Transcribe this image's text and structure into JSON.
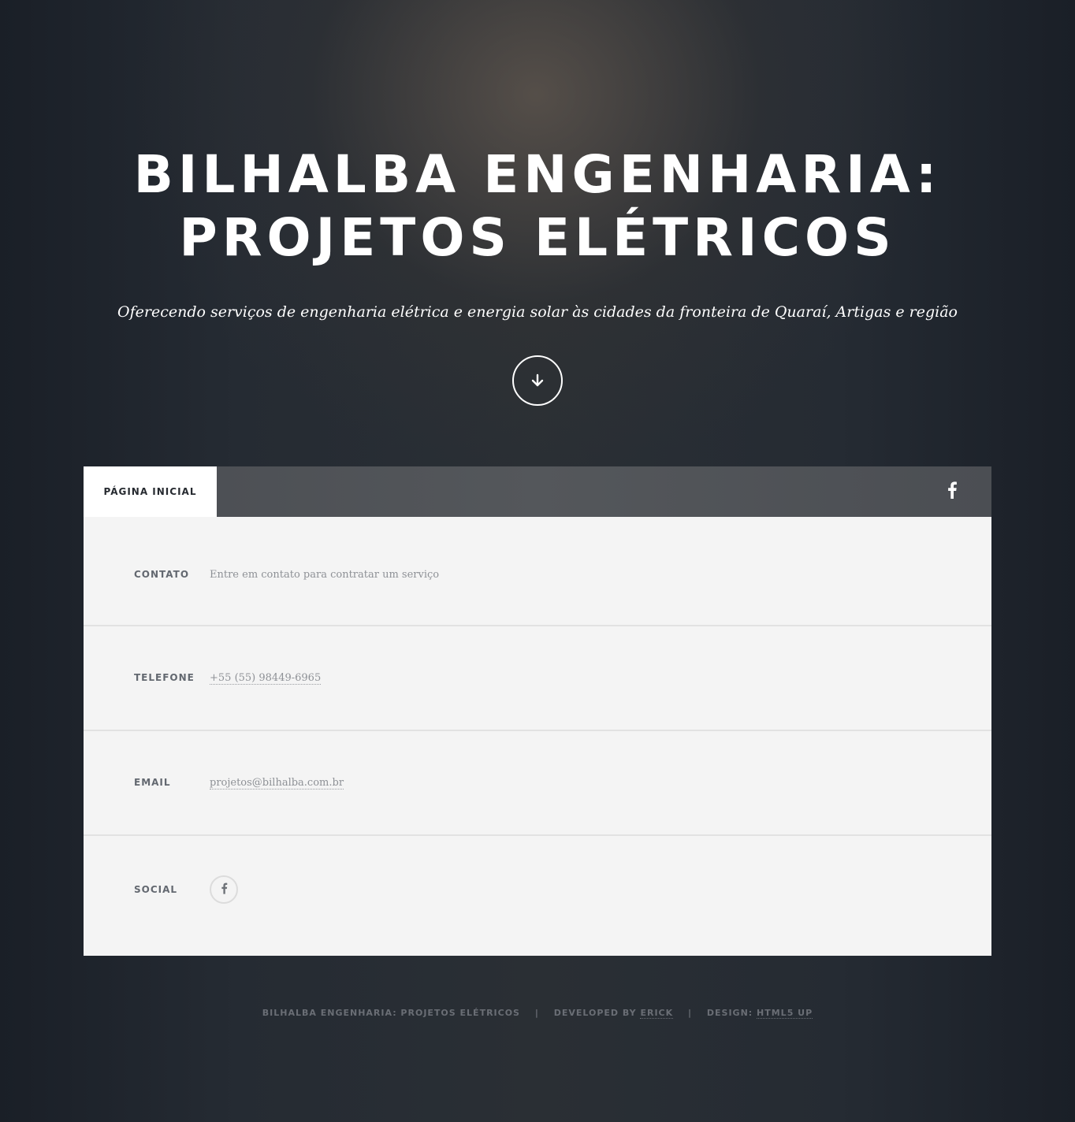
{
  "hero": {
    "title_line1": "BILHALBA ENGENHARIA:",
    "title_line2": "PROJETOS ELÉTRICOS",
    "subtitle": "Oferecendo serviços de engenharia elétrica e energia solar às cidades da fronteira de Quaraí, Artigas e região",
    "scroll_icon": "arrow-down-icon"
  },
  "nav": {
    "active_tab": "PÁGINA INICIAL",
    "social_icon": "facebook-icon"
  },
  "contact": {
    "rows": [
      {
        "label": "CONTATO",
        "value": "Entre em contato para contratar um serviço"
      },
      {
        "label": "TELEFONE",
        "value": "+55 (55) 98449-6965"
      },
      {
        "label": "EMAIL",
        "value": "projetos@bilhalba.com.br"
      },
      {
        "label": "SOCIAL",
        "icon": "facebook-icon"
      }
    ]
  },
  "footer": {
    "brand": "BILHALBA ENGENHARIA: PROJETOS ELÉTRICOS",
    "separator": "|",
    "developed_prefix": "DEVELOPED BY",
    "developer_link": "ERICK",
    "design_prefix": "DESIGN:",
    "design_link": "HTML5 UP"
  },
  "colors": {
    "background": "#1d222b",
    "panel": "#f4f4f4",
    "nav_bar": "#505357",
    "label": "#636870",
    "value": "#8e9196",
    "footer_text": "#6a6e75"
  }
}
